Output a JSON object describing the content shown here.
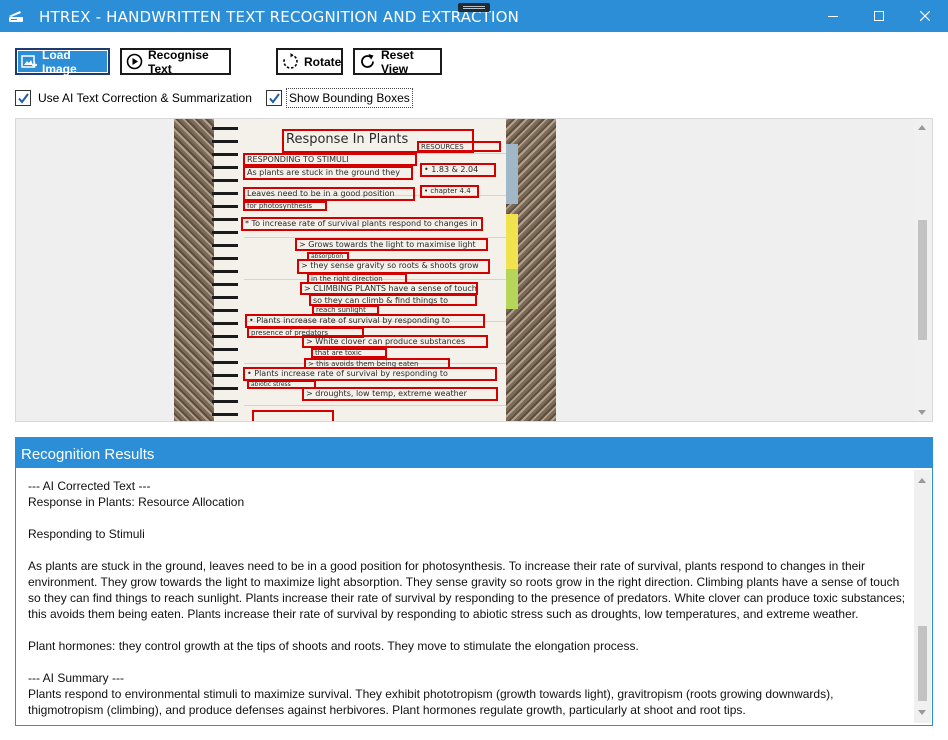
{
  "window": {
    "title": "HTREX - HANDWRITTEN TEXT RECOGNITION AND EXTRACTION",
    "accent_color": "#2b8ed6",
    "icons": {
      "app": "scanner-icon",
      "minimize": "minimize-icon",
      "maximize": "maximize-icon",
      "close": "close-icon"
    }
  },
  "toolbar": {
    "load_image": "Load Image",
    "recognise_text": "Recognise Text",
    "rotate": "Rotate",
    "reset_view": "Reset View"
  },
  "options": {
    "ai_correction": {
      "label": "Use AI Text Correction & Summarization",
      "checked": true
    },
    "bounding_boxes": {
      "label": "Show Bounding Boxes",
      "checked": true
    }
  },
  "image": {
    "boxes": [
      "Response In Plants",
      "RESPONDING TO STIMULI",
      "As plants are stuck in the ground they",
      "Leaves need to be in a good position",
      "for photosynthesis",
      "* To increase rate of survival plants respond to changes in",
      "> Grows towards the light to maximise light",
      "absorption",
      "> they sense gravity so roots & shoots grow",
      "in the right direction",
      "> CLIMBING PLANTS have a sense of touch",
      "so they can climb & find things to",
      "reach sunlight",
      "• Plants increase rate of survival by responding to",
      "presence of predators",
      "> White clover can produce substances",
      "that are toxic",
      "> this avoids them being eaten",
      "• Plants increase rate of survival by responding to",
      "abiotic stress",
      "> droughts, low temp, extreme weather",
      "RESOURCES",
      "• 1.83 & 2.04",
      "• chapter 4.4"
    ]
  },
  "results": {
    "header": "Recognition Results",
    "lines": [
      "--- AI Corrected Text ---",
      "Response in Plants: Resource Allocation",
      "",
      "Responding to Stimuli",
      "",
      "As plants are stuck in the ground, leaves need to be in a good position for photosynthesis.  To increase their rate of survival, plants respond to changes in their environment. They grow towards the light to maximize light absorption. They sense gravity so roots grow in the right direction. Climbing plants have a sense of touch so they can find things to reach sunlight. Plants increase their rate of survival by responding to the presence of predators. White clover can produce toxic substances; this avoids them being eaten. Plants increase their rate of survival by responding to abiotic stress such as droughts, low temperatures, and extreme weather.",
      "",
      "Plant hormones: they control growth at the tips of shoots and roots.  They move to stimulate the elongation process.",
      "",
      "--- AI Summary ---",
      "Plants respond to environmental stimuli to maximize survival.  They exhibit phototropism (growth towards light), gravitropism (roots growing downwards), thigmotropism (climbing), and produce defenses against herbivores.  Plant hormones regulate growth, particularly at shoot and root tips."
    ]
  }
}
